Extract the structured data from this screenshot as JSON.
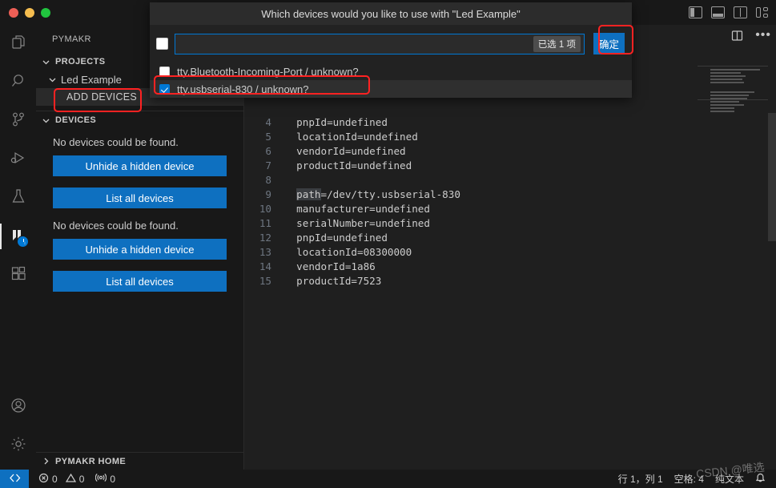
{
  "window": {
    "traffic_lights": [
      "close",
      "minimize",
      "maximize"
    ],
    "layout_icons": [
      "toggle-primary-sidebar",
      "toggle-panel",
      "toggle-secondary-sidebar",
      "customize-layout"
    ]
  },
  "activity_bar": {
    "items": [
      {
        "name": "explorer",
        "icon": "files-icon"
      },
      {
        "name": "search",
        "icon": "search-icon"
      },
      {
        "name": "source-control",
        "icon": "source-control-icon"
      },
      {
        "name": "run-and-debug",
        "icon": "run-debug-icon"
      },
      {
        "name": "testing",
        "icon": "beaker-icon"
      },
      {
        "name": "pymakr",
        "icon": "pymakr-icon",
        "badge": "clock"
      },
      {
        "name": "extensions",
        "icon": "extensions-icon"
      }
    ],
    "bottom": [
      {
        "name": "accounts",
        "icon": "account-icon"
      },
      {
        "name": "manage",
        "icon": "gear-icon"
      }
    ]
  },
  "sidebar": {
    "title": "PYMAKR",
    "projects": {
      "label": "PROJECTS",
      "items": [
        {
          "label": "Led Example",
          "expanded": true
        },
        {
          "label": "ADD DEVICES",
          "selected": true,
          "annotated": true
        }
      ]
    },
    "devices": {
      "label": "DEVICES",
      "blocks": [
        {
          "message": "No devices could be found.",
          "buttons": [
            "Unhide a hidden device",
            "List all devices"
          ]
        },
        {
          "message": "No devices could be found.",
          "buttons": [
            "Unhide a hidden device",
            "List all devices"
          ]
        }
      ]
    },
    "pymakr_home": "PYMAKR HOME"
  },
  "editor": {
    "toolbar": [
      {
        "name": "split-editor",
        "icon": "split-editor-icon"
      },
      {
        "name": "more-actions",
        "icon": "ellipsis-icon"
      }
    ],
    "lines": [
      {
        "num": "4",
        "text": "  pnpId=undefined"
      },
      {
        "num": "5",
        "text": "  locationId=undefined"
      },
      {
        "num": "6",
        "text": "  vendorId=undefined"
      },
      {
        "num": "7",
        "text": "  productId=undefined"
      },
      {
        "num": "8",
        "text": ""
      },
      {
        "num": "9",
        "text": "  path=/dev/tty.usbserial-830",
        "highlight": "path"
      },
      {
        "num": "10",
        "text": "  manufacturer=undefined"
      },
      {
        "num": "11",
        "text": "  serialNumber=undefined"
      },
      {
        "num": "12",
        "text": "  pnpId=undefined"
      },
      {
        "num": "13",
        "text": "  locationId=08300000"
      },
      {
        "num": "14",
        "text": "  vendorId=1a86"
      },
      {
        "num": "15",
        "text": "  productId=7523"
      }
    ]
  },
  "dialog": {
    "title": "Which devices would you like to use with \"Led Example\"",
    "select_all_checked": false,
    "input_value": "",
    "input_placeholder": "",
    "selected_badge": "已选 1 项",
    "confirm_label": "确定",
    "items": [
      {
        "label": "tty.Bluetooth-Incoming-Port / unknown?",
        "checked": false,
        "selected": false,
        "annotated": false
      },
      {
        "label": "tty.usbserial-830 / unknown?",
        "checked": true,
        "selected": true,
        "annotated": true
      }
    ]
  },
  "status_bar": {
    "remote_icon": "remote-indicator-icon",
    "errors": "0",
    "warnings": "0",
    "ports": "0",
    "cursor_position": "行 1，列 1",
    "indentation": "空格: 4",
    "language": "纯文本",
    "bell_icon": "bell-icon"
  },
  "watermark": "CSDN @唯选",
  "colors": {
    "accent_blue": "#0e70c0",
    "checkbox_blue": "#0078d4",
    "annotation_red": "#ff2222",
    "editor_bg": "#1f1f1f",
    "chrome_bg": "#181818",
    "dialog_bg": "#222222"
  }
}
